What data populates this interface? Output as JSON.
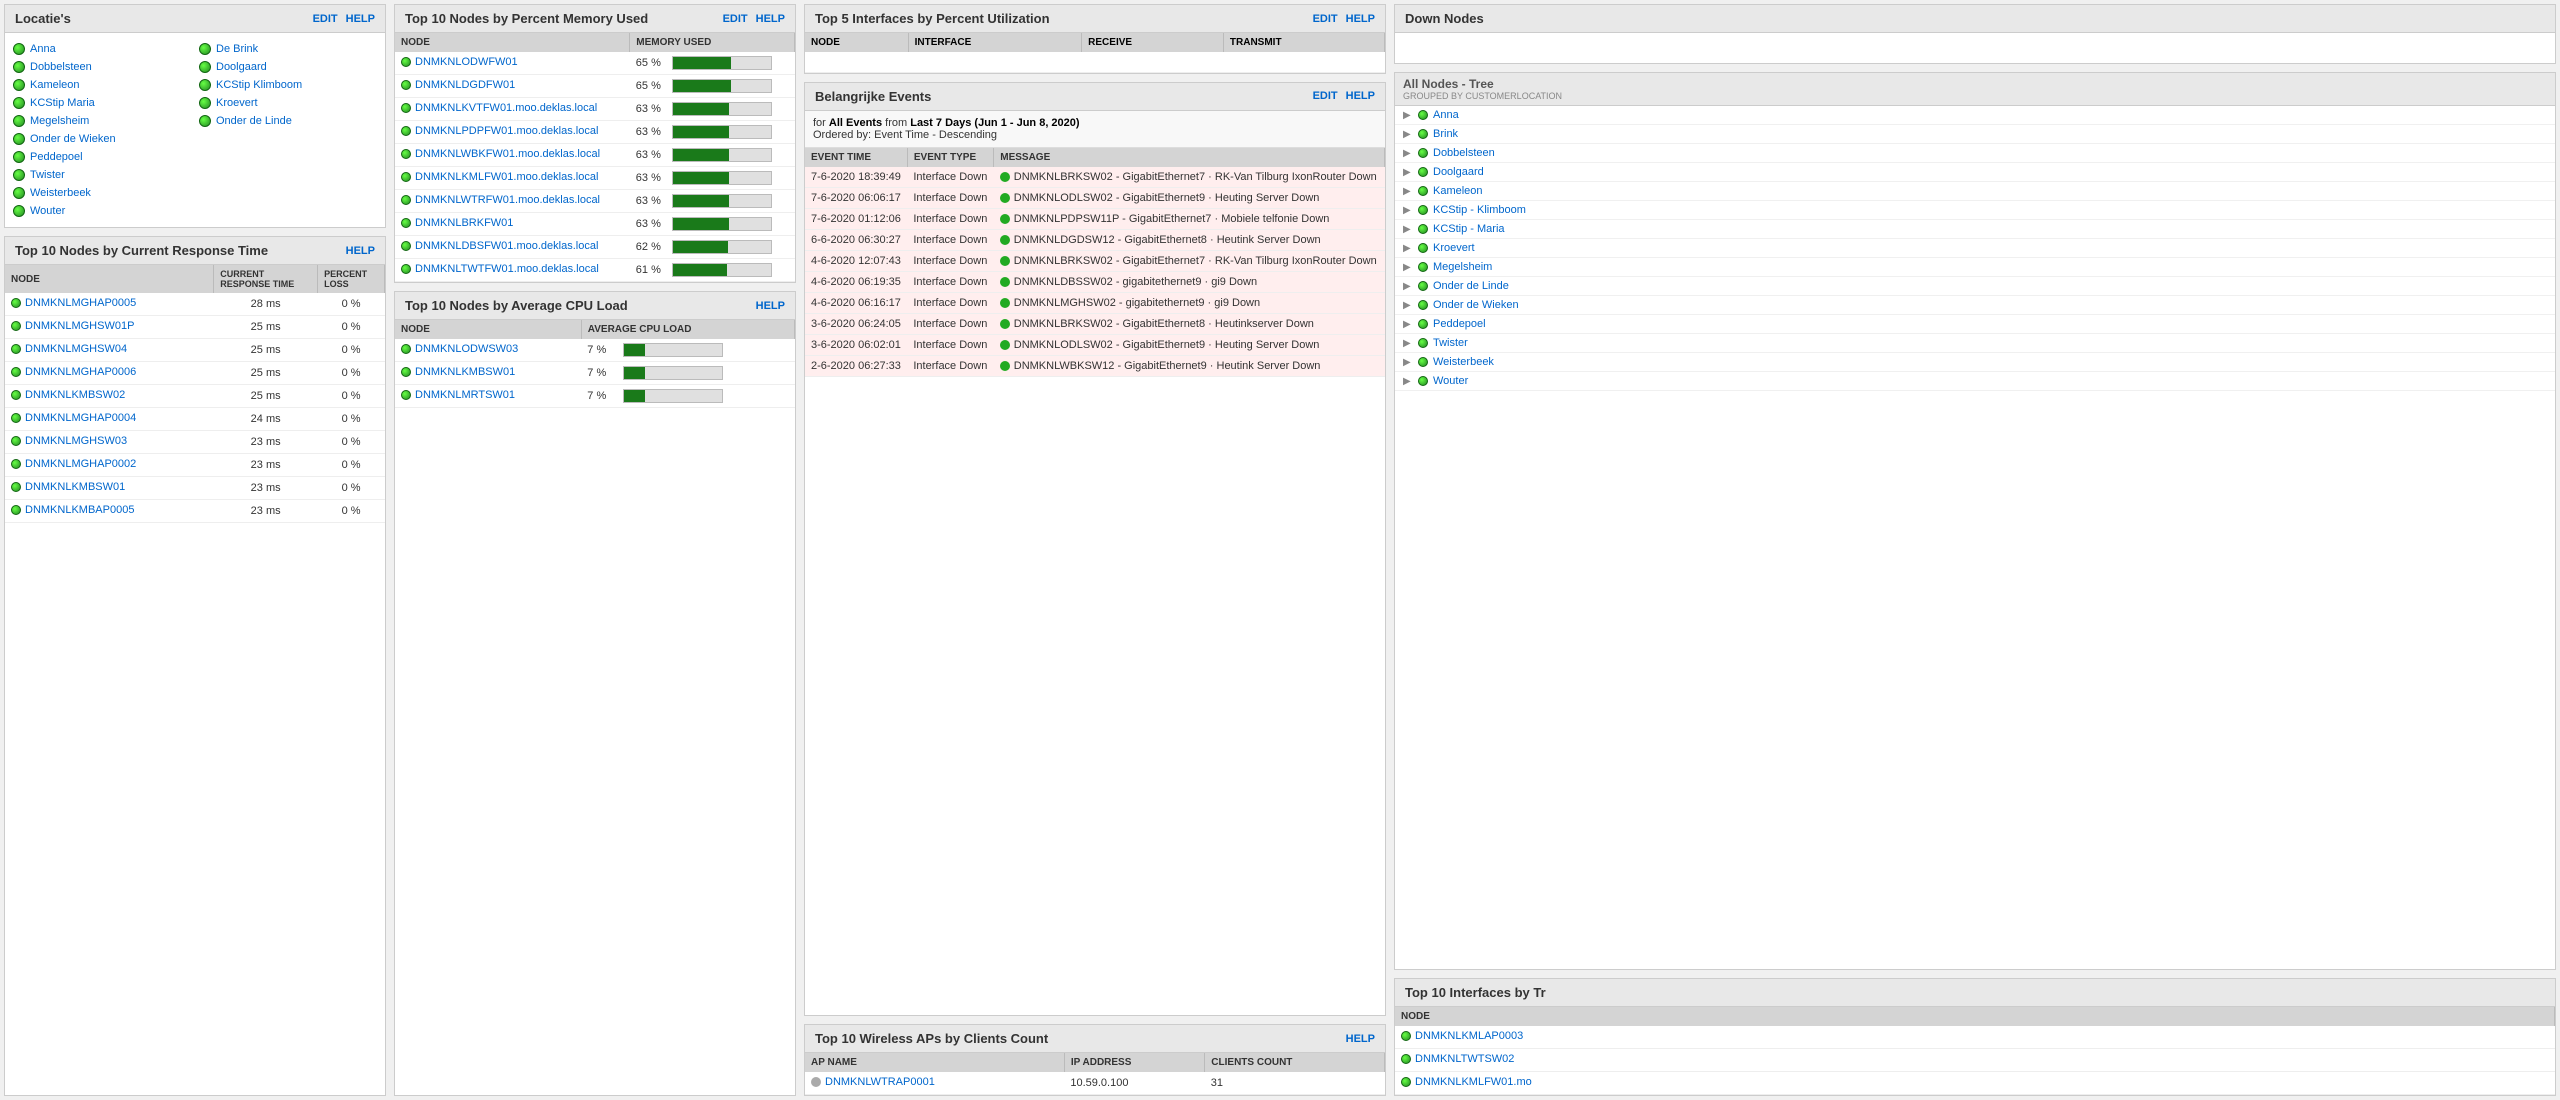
{
  "locaties": {
    "title": "Locatie's",
    "actions": [
      "EDIT",
      "HELP"
    ],
    "items_col1": [
      {
        "name": "Anna",
        "status": "green"
      },
      {
        "name": "Dobbelsteen",
        "status": "green"
      },
      {
        "name": "Kameleon",
        "status": "green"
      },
      {
        "name": "KCStip Maria",
        "status": "green"
      },
      {
        "name": "Megelsheim",
        "status": "green"
      },
      {
        "name": "Onder de Wieken",
        "status": "green"
      },
      {
        "name": "Peddepoel",
        "status": "green"
      },
      {
        "name": "Twister",
        "status": "green"
      },
      {
        "name": "Weisterbeek",
        "status": "green"
      },
      {
        "name": "Wouter",
        "status": "green"
      }
    ],
    "items_col2": [
      {
        "name": "De Brink",
        "status": "green"
      },
      {
        "name": "Doolgaard",
        "status": "green"
      },
      {
        "name": "KCStip Klimboom",
        "status": "green"
      },
      {
        "name": "Kroevert",
        "status": "green"
      },
      {
        "name": "Onder de Linde",
        "status": "green"
      }
    ]
  },
  "response_time": {
    "title": "Top 10 Nodes by Current Response Time",
    "actions": [
      "HELP"
    ],
    "columns": [
      "NODE",
      "CURRENT RESPONSE TIME",
      "PERCENT LOSS"
    ],
    "rows": [
      {
        "node": "DNMKNLMGHAP0005",
        "time": "28 ms",
        "loss": "0 %"
      },
      {
        "node": "DNMKNLMGHSW01P",
        "time": "25 ms",
        "loss": "0 %"
      },
      {
        "node": "DNMKNLMGHSW04",
        "time": "25 ms",
        "loss": "0 %"
      },
      {
        "node": "DNMKNLMGHAP0006",
        "time": "25 ms",
        "loss": "0 %"
      },
      {
        "node": "DNMKNLKMBSW02",
        "time": "25 ms",
        "loss": "0 %"
      },
      {
        "node": "DNMKNLMGHAP0004",
        "time": "24 ms",
        "loss": "0 %"
      },
      {
        "node": "DNMKNLMGHSW03",
        "time": "23 ms",
        "loss": "0 %"
      },
      {
        "node": "DNMKNLMGHAP0002",
        "time": "23 ms",
        "loss": "0 %"
      },
      {
        "node": "DNMKNLKMBSW01",
        "time": "23 ms",
        "loss": "0 %"
      },
      {
        "node": "DNMKNLKMBAP0005",
        "time": "23 ms",
        "loss": "0 %"
      }
    ]
  },
  "memory": {
    "title": "Top 10 Nodes by Percent Memory Used",
    "actions": [
      "EDIT",
      "HELP"
    ],
    "columns": [
      "NODE",
      "MEMORY USED"
    ],
    "rows": [
      {
        "node": "DNMKNLODWFW01",
        "pct": 65,
        "label": "65 %"
      },
      {
        "node": "DNMKNLDGDFW01",
        "pct": 65,
        "label": "65 %"
      },
      {
        "node": "DNMKNLKVTFW01.moo.deklas.local",
        "pct": 63,
        "label": "63 %"
      },
      {
        "node": "DNMKNLPDPFW01.moo.deklas.local",
        "pct": 63,
        "label": "63 %"
      },
      {
        "node": "DNMKNLWBKFW01.moo.deklas.local",
        "pct": 63,
        "label": "63 %"
      },
      {
        "node": "DNMKNLKMLFW01.moo.deklas.local",
        "pct": 63,
        "label": "63 %"
      },
      {
        "node": "DNMKNLWTRFW01.moo.deklas.local",
        "pct": 63,
        "label": "63 %"
      },
      {
        "node": "DNMKNLBRKFW01",
        "pct": 63,
        "label": "63 %"
      },
      {
        "node": "DNMKNLDBSFW01.moo.deklas.local",
        "pct": 62,
        "label": "62 %"
      },
      {
        "node": "DNMKNLTWTFW01.moo.deklas.local",
        "pct": 61,
        "label": "61 %"
      }
    ]
  },
  "cpu": {
    "title": "Top 10 Nodes by Average CPU Load",
    "actions": [
      "HELP"
    ],
    "columns": [
      "NODE",
      "AVERAGE CPU LOAD"
    ],
    "rows": [
      {
        "node": "DNMKNLODWSW03",
        "pct": 7,
        "label": "7 %"
      },
      {
        "node": "DNMKNLKMBSW01",
        "pct": 7,
        "label": "7 %"
      },
      {
        "node": "DNMKNLMRTSW01",
        "pct": 7,
        "label": "7 %"
      }
    ]
  },
  "interfaces": {
    "title": "Top 5 Interfaces by Percent Utilization",
    "actions": [
      "EDIT",
      "HELP"
    ],
    "columns": [
      "NODE",
      "INTERFACE",
      "RECEIVE",
      "TRANSMIT"
    ],
    "rows": []
  },
  "events": {
    "title": "Belangrijke Events",
    "actions": [
      "EDIT",
      "HELP"
    ],
    "filter_text": "for All Events from Last 7 Days (Jun 1 - Jun 8, 2020)",
    "order_text": "Ordered by: Event Time - Descending",
    "columns": [
      "EVENT TIME",
      "EVENT TYPE",
      "MESSAGE"
    ],
    "rows": [
      {
        "time": "7-6-2020 18:39:49",
        "type": "Interface Down",
        "dot": "green",
        "message": "DNMKNLBRKSW02 - GigabitEthernet7 · RK-Van Tilburg IxonRouter Down"
      },
      {
        "time": "7-6-2020 06:06:17",
        "type": "Interface Down",
        "dot": "green",
        "message": "DNMKNLODLSW02 - GigabitEthernet9 · Heuting Server Down"
      },
      {
        "time": "7-6-2020 01:12:06",
        "type": "Interface Down",
        "dot": "green",
        "message": "DNMKNLPDPSW11P - GigabitEthernet7 · Mobiele telfonie Down"
      },
      {
        "time": "6-6-2020 06:30:27",
        "type": "Interface Down",
        "dot": "green",
        "message": "DNMKNLDGDSW12 - GigabitEthernet8 · Heutink Server Down"
      },
      {
        "time": "4-6-2020 12:07:43",
        "type": "Interface Down",
        "dot": "green",
        "message": "DNMKNLBRKSW02 - GigabitEthernet7 · RK-Van Tilburg IxonRouter Down"
      },
      {
        "time": "4-6-2020 06:19:35",
        "type": "Interface Down",
        "dot": "green",
        "message": "DNMKNLDBSSW02 - gigabitethernet9 · gi9 Down"
      },
      {
        "time": "4-6-2020 06:16:17",
        "type": "Interface Down",
        "dot": "green",
        "message": "DNMKNLMGHSW02 - gigabitethernet9 · gi9 Down"
      },
      {
        "time": "3-6-2020 06:24:05",
        "type": "Interface Down",
        "dot": "green",
        "message": "DNMKNLBRKSW02 - GigabitEthernet8 · Heutinkserver Down"
      },
      {
        "time": "3-6-2020 06:02:01",
        "type": "Interface Down",
        "dot": "green",
        "message": "DNMKNLODLSW02 - GigabitEthernet9 · Heuting Server Down"
      },
      {
        "time": "2-6-2020 06:27:33",
        "type": "Interface Down",
        "dot": "green",
        "message": "DNMKNLWBKSW12 - GigabitEthernet9 · Heutink Server Down"
      }
    ]
  },
  "wireless": {
    "title": "Top 10 Wireless APs by Clients Count",
    "actions": [
      "HELP"
    ],
    "columns": [
      "AP NAME",
      "IP ADDRESS",
      "CLIENTS COUNT"
    ],
    "rows": [
      {
        "ap": "DNMKNLWTRAP0001",
        "ip": "10.59.0.100",
        "count": "31"
      }
    ]
  },
  "down_nodes": {
    "title": "Down Nodes"
  },
  "all_nodes_tree": {
    "title": "All Nodes - Tree",
    "subtitle": "GROUPED BY CUSTOMERLOCATION",
    "items": [
      "Anna",
      "Brink",
      "Dobbelsteen",
      "Doolgaard",
      "Kameleon",
      "KCStip - Klimboom",
      "KCStip - Maria",
      "Kroevert",
      "Megelsheim",
      "Onder de Linde",
      "Onder de Wieken",
      "Peddepoel",
      "Twister",
      "Weisterbeek",
      "Wouter"
    ]
  },
  "bottom_interfaces": {
    "title": "Top 10 Interfaces by Tr",
    "columns": [
      "NODE"
    ],
    "rows": [
      {
        "node": "DNMKNLKMLAP0003"
      },
      {
        "node": "DNMKNLTWTSW02"
      },
      {
        "node": "DNMKNLKMLFW01.mo"
      }
    ]
  }
}
